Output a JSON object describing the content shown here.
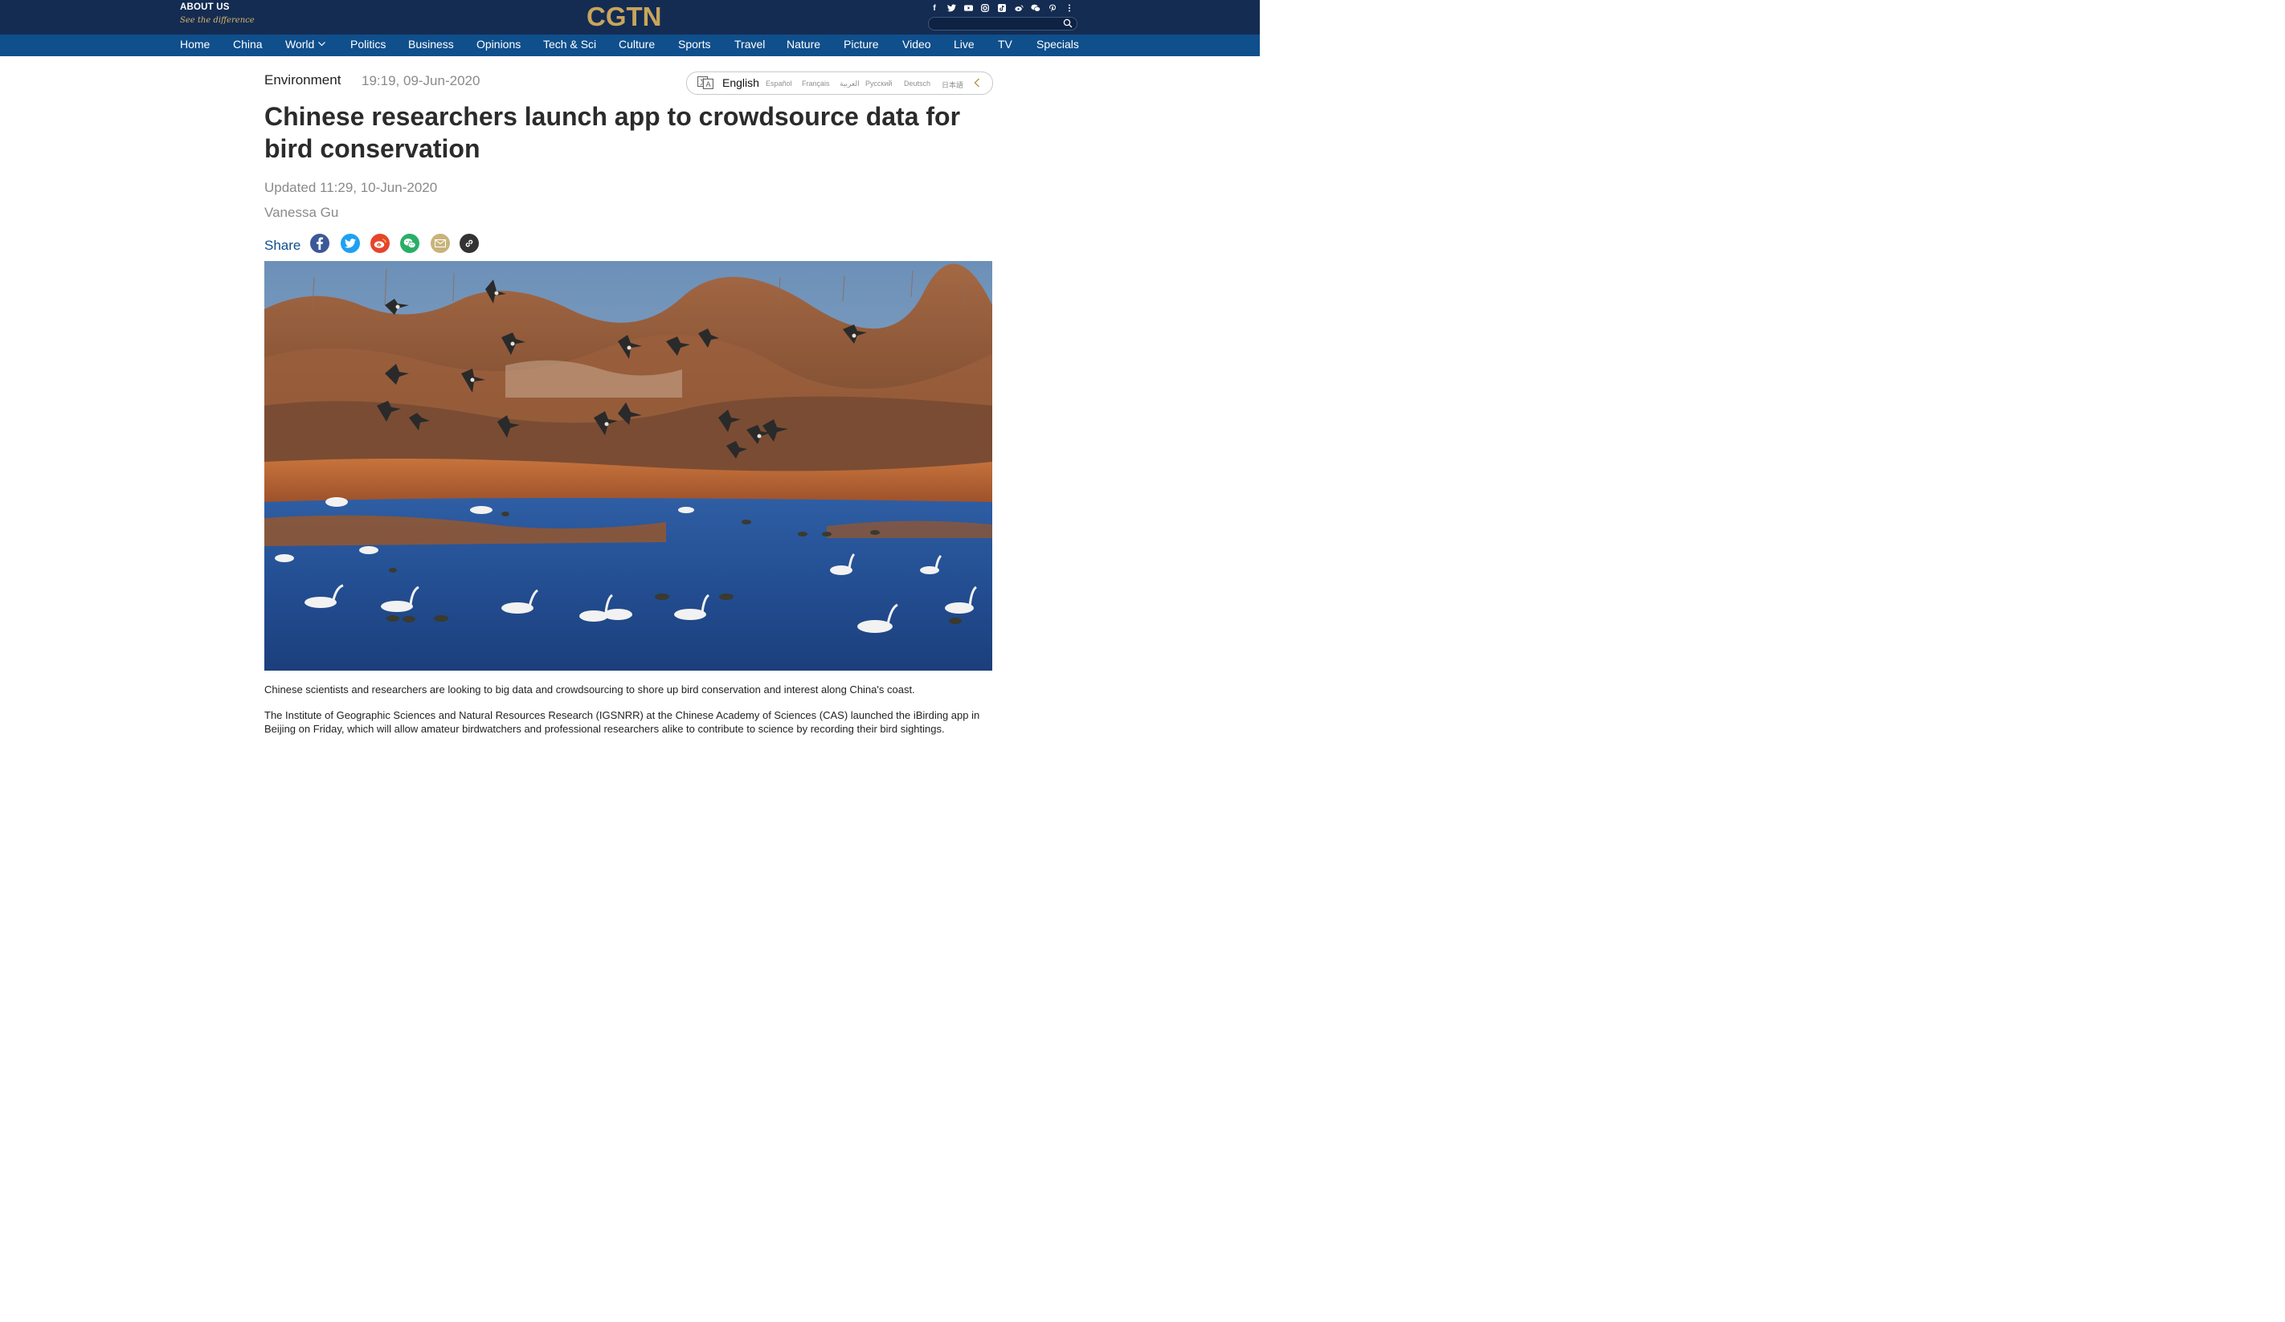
{
  "header": {
    "about_label": "ABOUT US",
    "slogan": "See the difference",
    "logo": "CGTN",
    "social_icons": [
      "facebook-icon",
      "twitter-icon",
      "youtube-icon",
      "instagram-icon",
      "tiktok-icon",
      "weibo-icon",
      "wechat-icon",
      "pinterest-icon",
      "more-icon"
    ],
    "search_placeholder": ""
  },
  "nav": {
    "items": [
      "Home",
      "China",
      "World",
      "Politics",
      "Business",
      "Opinions",
      "Tech & Sci",
      "Culture",
      "Sports",
      "Travel",
      "Nature",
      "Picture",
      "Video",
      "Live",
      "TV",
      "Specials"
    ]
  },
  "article": {
    "category": "Environment",
    "date": "19:19, 09-Jun-2020",
    "title": "Chinese researchers launch app to crowdsource data for bird conservation",
    "updated": "Updated 11:29, 10-Jun-2020",
    "author": "Vanessa Gu",
    "share_label": "Share",
    "share_icons": [
      "facebook-icon",
      "twitter-icon",
      "weibo-icon",
      "wechat-icon",
      "email-icon",
      "link-icon"
    ],
    "image_alt": "Geese flying over a wetland where swans swim",
    "paragraphs": [
      "Chinese scientists and researchers are looking to big data and crowdsourcing to shore up bird conservation and interest along China's coast.",
      "The Institute of Geographic Sciences and Natural Resources Research (IGSNRR) at the Chinese Academy of Sciences (CAS) launched the iBirding app in Beijing on Friday, which will allow amateur birdwatchers and professional researchers alike to contribute to science by recording their bird sightings."
    ]
  },
  "languages": {
    "current": "English",
    "others": [
      "Español",
      "Français",
      "العربية",
      "Русский",
      "Deutsch",
      "日本語"
    ]
  },
  "colors": {
    "topbar": "#142c52",
    "navbar": "#0f4f8c",
    "logo_gold": "#c9a55b",
    "share_blue": "#0f4f8c",
    "facebook": "#3b5998",
    "twitter": "#1da1f2",
    "weibo": "#e6452b",
    "wechat": "#2aae67",
    "email": "#c8b37a",
    "link": "#333333"
  }
}
